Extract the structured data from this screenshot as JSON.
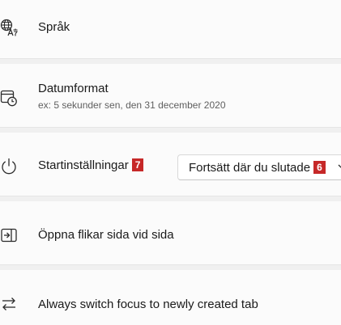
{
  "rows": {
    "language": {
      "label": "Språk",
      "icon": "language-icon"
    },
    "date_format": {
      "label": "Datumformat",
      "example": "ex: 5 sekunder sen, den 31 december 2020",
      "icon": "calendar-clock-icon"
    },
    "startup": {
      "label": "Startinställningar",
      "label_badge": "7",
      "icon": "power-icon",
      "dropdown": {
        "value": "Fortsätt där du slutade",
        "badge": "6",
        "icon": "chevron-down-icon"
      }
    },
    "side_by_side": {
      "label": "Öppna flikar sida vid sida",
      "icon": "split-tabs-icon"
    },
    "switch_focus": {
      "label": "Always switch focus to newly created tab",
      "icon": "switch-arrows-icon"
    }
  },
  "colors": {
    "badge": "#c62828",
    "row_background": "#fbfbfb",
    "page_background": "#f0f0f0"
  }
}
